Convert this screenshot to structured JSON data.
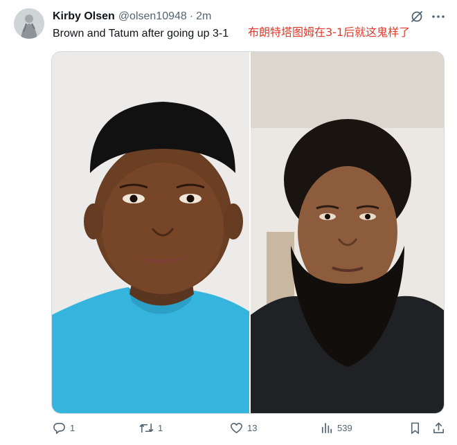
{
  "author": {
    "name": "Kirby Olsen",
    "handle": "@olsen10948",
    "separator": "·",
    "time": "2m"
  },
  "tweet": {
    "text": "Brown and Tatum after going up 3-1",
    "annotation": "布朗特塔图姆在3-1后就这鬼样了"
  },
  "actions": {
    "replies": "1",
    "reposts": "1",
    "likes": "13",
    "views": "539"
  },
  "icons": {
    "grok": "grok-icon",
    "more": "more-icon",
    "reply": "reply-icon",
    "repost": "repost-icon",
    "like": "heart-icon",
    "views": "views-icon",
    "bookmark": "bookmark-icon",
    "share": "share-icon"
  },
  "colors": {
    "annotation": "#e03a2b",
    "secondary_text": "#536471",
    "left_shirt": "#35b4dd",
    "right_cape": "#1f2124"
  }
}
